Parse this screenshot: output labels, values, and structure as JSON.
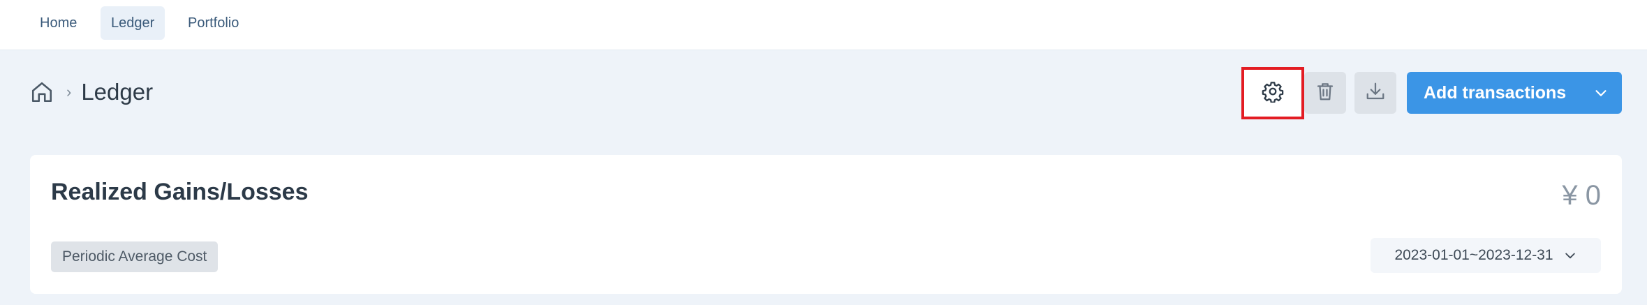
{
  "nav": {
    "items": [
      {
        "label": "Home",
        "active": false
      },
      {
        "label": "Ledger",
        "active": true
      },
      {
        "label": "Portfolio",
        "active": false
      }
    ]
  },
  "header": {
    "breadcrumb_home_icon": "home-icon",
    "breadcrumb_separator": "›",
    "title": "Ledger",
    "actions": {
      "settings_icon": "gear-icon",
      "delete_icon": "trash-icon",
      "download_icon": "download-icon",
      "add_label": "Add transactions",
      "add_caret_icon": "chevron-down-icon"
    }
  },
  "card": {
    "title": "Realized Gains/Losses",
    "amount": "¥ 0",
    "method": "Periodic Average Cost",
    "date_range": "2023-01-01~2023-12-31"
  },
  "colors": {
    "accent": "#3b95e6",
    "highlight_border": "#e31c23",
    "background": "#eef3f9"
  }
}
